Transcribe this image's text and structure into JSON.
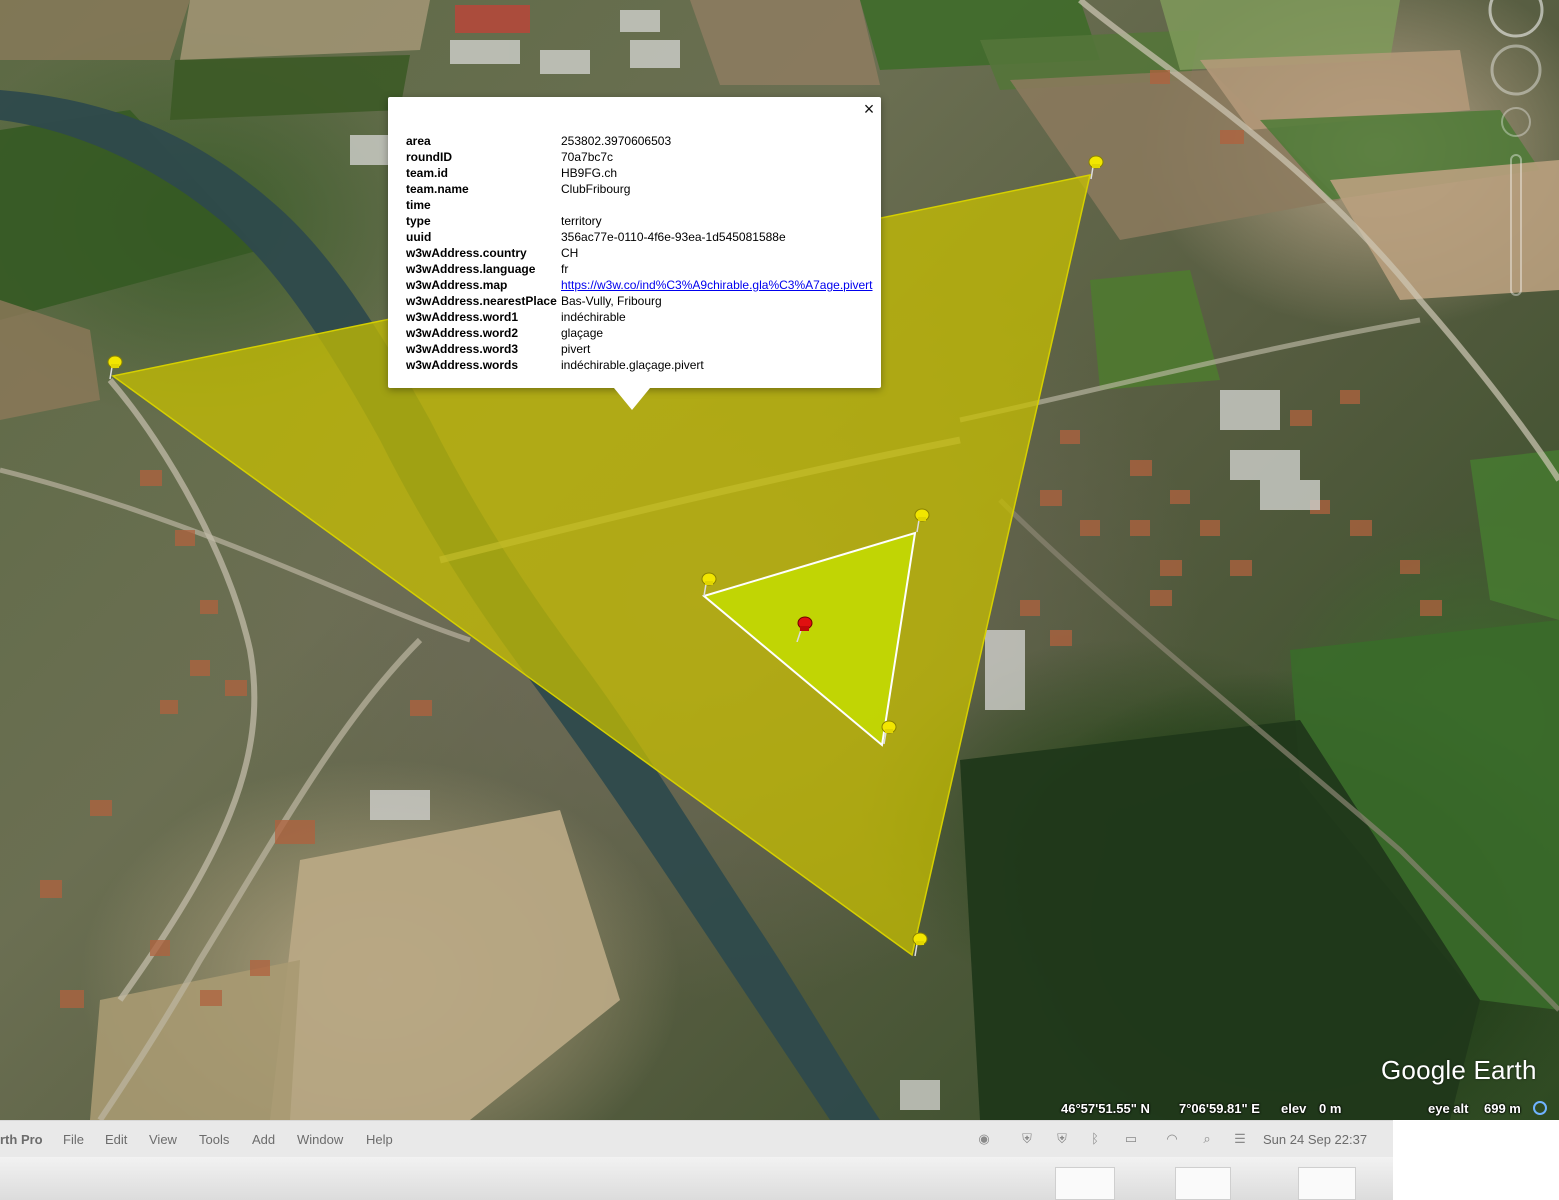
{
  "popup": {
    "close_label": "×",
    "rows": [
      {
        "key": "area",
        "value": "253802.3970606503"
      },
      {
        "key": "roundID",
        "value": "70a7bc7c"
      },
      {
        "key": "team.id",
        "value": "HB9FG.ch"
      },
      {
        "key": "team.name",
        "value": "ClubFribourg"
      },
      {
        "key": "time",
        "value": ""
      },
      {
        "key": "type",
        "value": "territory"
      },
      {
        "key": "uuid",
        "value": "356ac77e-0110-4f6e-93ea-1d545081588e"
      },
      {
        "key": "w3wAddress.country",
        "value": "CH"
      },
      {
        "key": "w3wAddress.language",
        "value": "fr"
      },
      {
        "key": "w3wAddress.map",
        "value": "https://w3w.co/ind%C3%A9chirable.gla%C3%A7age.pivert"
      },
      {
        "key": "w3wAddress.nearestPlace",
        "value": "Bas-Vully, Fribourg"
      },
      {
        "key": "w3wAddress.word1",
        "value": "indéchirable"
      },
      {
        "key": "w3wAddress.word2",
        "value": "glaçage"
      },
      {
        "key": "w3wAddress.word3",
        "value": "pivert"
      },
      {
        "key": "w3wAddress.words",
        "value": "indéchirable.glaçage.pivert"
      }
    ]
  },
  "statusbar": {
    "lat": "46°57'51.55\" N",
    "lon": "7°06'59.81\" E",
    "elev_label": "elev",
    "elev_value": "0 m",
    "eye_alt_label": "eye alt",
    "eye_alt_value": "699 m"
  },
  "logo": "Google Earth",
  "menubar": {
    "app_name": "rth Pro",
    "items": [
      "File",
      "Edit",
      "View",
      "Tools",
      "Add",
      "Window",
      "Help"
    ],
    "clock": "Sun 24 Sep  22:37"
  },
  "colors": {
    "large_territory": "#c8c000",
    "small_territory": "#c6e000",
    "pin_yellow": "#f2e600",
    "pin_red": "#e01010"
  }
}
